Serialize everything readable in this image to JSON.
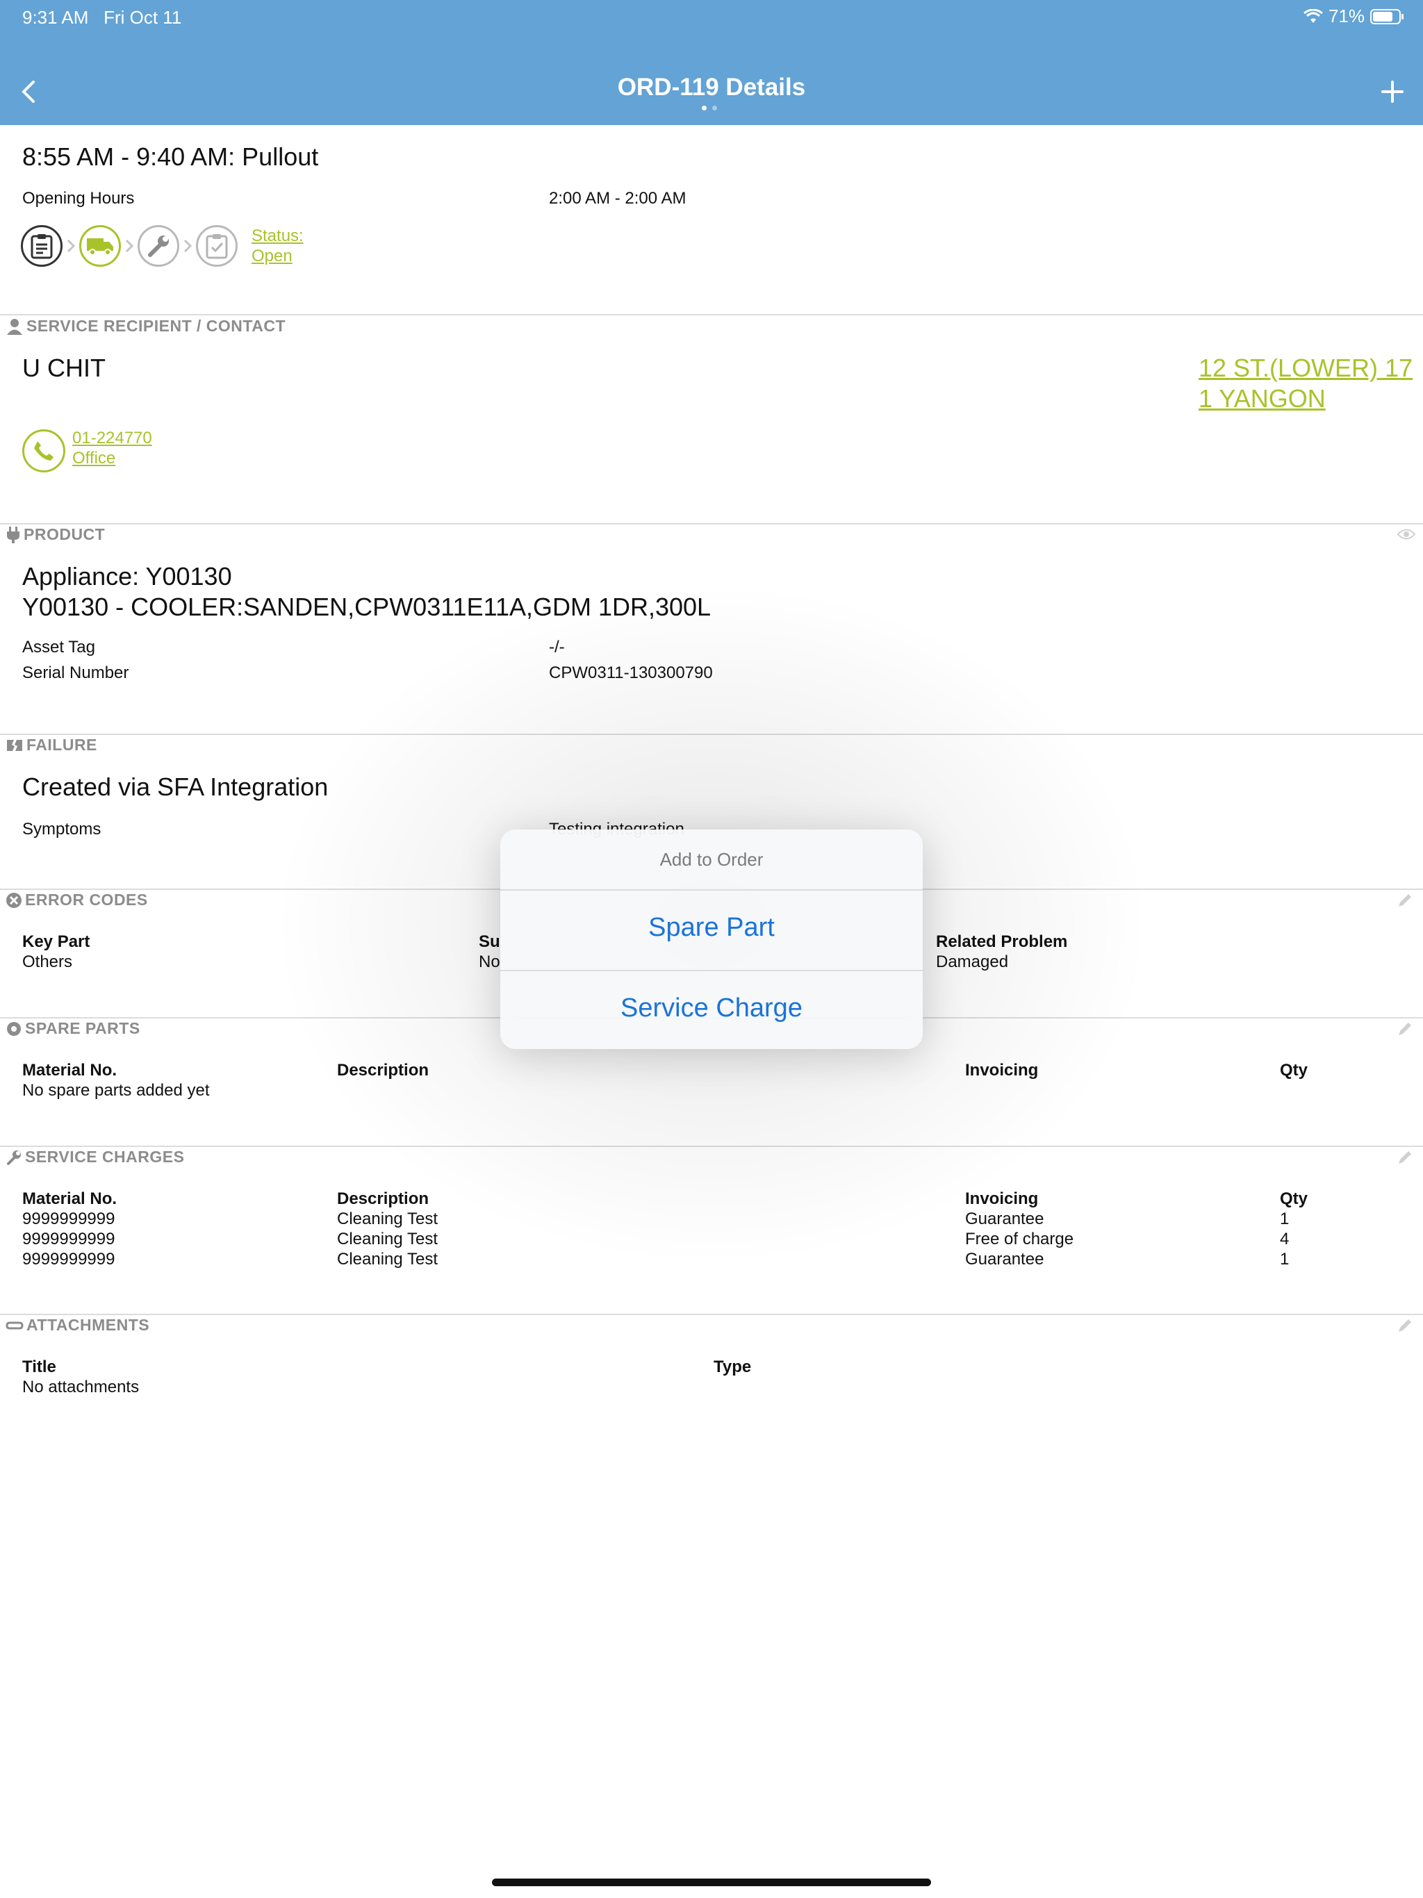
{
  "status_bar": {
    "time": "9:31 AM",
    "date": "Fri Oct 11",
    "battery": "71%",
    "icons": [
      "wifi-icon",
      "battery-icon"
    ]
  },
  "nav": {
    "title": "ORD-119 Details",
    "back_icon": "chevron-left-icon",
    "add_icon": "plus-icon"
  },
  "header": {
    "slot": "8:55 AM - 9:40 AM: Pullout",
    "opening_label": "Opening Hours",
    "opening_value": "2:00 AM - 2:00 AM",
    "status_line1": "Status:",
    "status_line2": "Open"
  },
  "recipient": {
    "section": "SERVICE RECIPIENT / CONTACT",
    "name": "U CHIT",
    "address_line1": "12 ST.(LOWER) 17",
    "address_line2": "1 YANGON",
    "phone": "01-224770",
    "phone_type": "Office"
  },
  "product": {
    "section": "PRODUCT",
    "line1": "Appliance: Y00130",
    "line2": "Y00130 - COOLER:SANDEN,CPW0311E11A,GDM 1DR,300L",
    "asset_label": "Asset Tag",
    "asset_value": "-/-",
    "serial_label": "Serial Number",
    "serial_value": "CPW0311-130300790"
  },
  "failure": {
    "section": "FAILURE",
    "title": "Created via SFA Integration",
    "symptoms_label": "Symptoms",
    "symptoms_value": "Testing integration"
  },
  "error_codes": {
    "section": "ERROR CODES",
    "key_part_label": "Key Part",
    "key_part_value": "Others",
    "sub_label": "Su",
    "sub_value": "No",
    "related_label": "Related Problem",
    "related_value": "Damaged"
  },
  "spare_parts": {
    "section": "SPARE PARTS",
    "columns": [
      "Material No.",
      "Description",
      "Invoicing",
      "Qty"
    ],
    "empty": "No spare parts added yet"
  },
  "service_charges": {
    "section": "SERVICE CHARGES",
    "columns": [
      "Material No.",
      "Description",
      "Invoicing",
      "Qty"
    ],
    "rows": [
      [
        "9999999999",
        "Cleaning Test",
        "Guarantee",
        "1"
      ],
      [
        "9999999999",
        "Cleaning Test",
        "Free of charge",
        "4"
      ],
      [
        "9999999999",
        "Cleaning Test",
        "Guarantee",
        "1"
      ]
    ]
  },
  "attachments": {
    "section": "ATTACHMENTS",
    "columns": [
      "Title",
      "Type"
    ],
    "empty": "No attachments"
  },
  "popover": {
    "title": "Add to Order",
    "options": [
      "Spare Part",
      "Service Charge"
    ]
  },
  "colors": {
    "nav_blue": "#63a3d5",
    "accent_green": "#a8c32a",
    "link_blue": "#1a73d9"
  }
}
